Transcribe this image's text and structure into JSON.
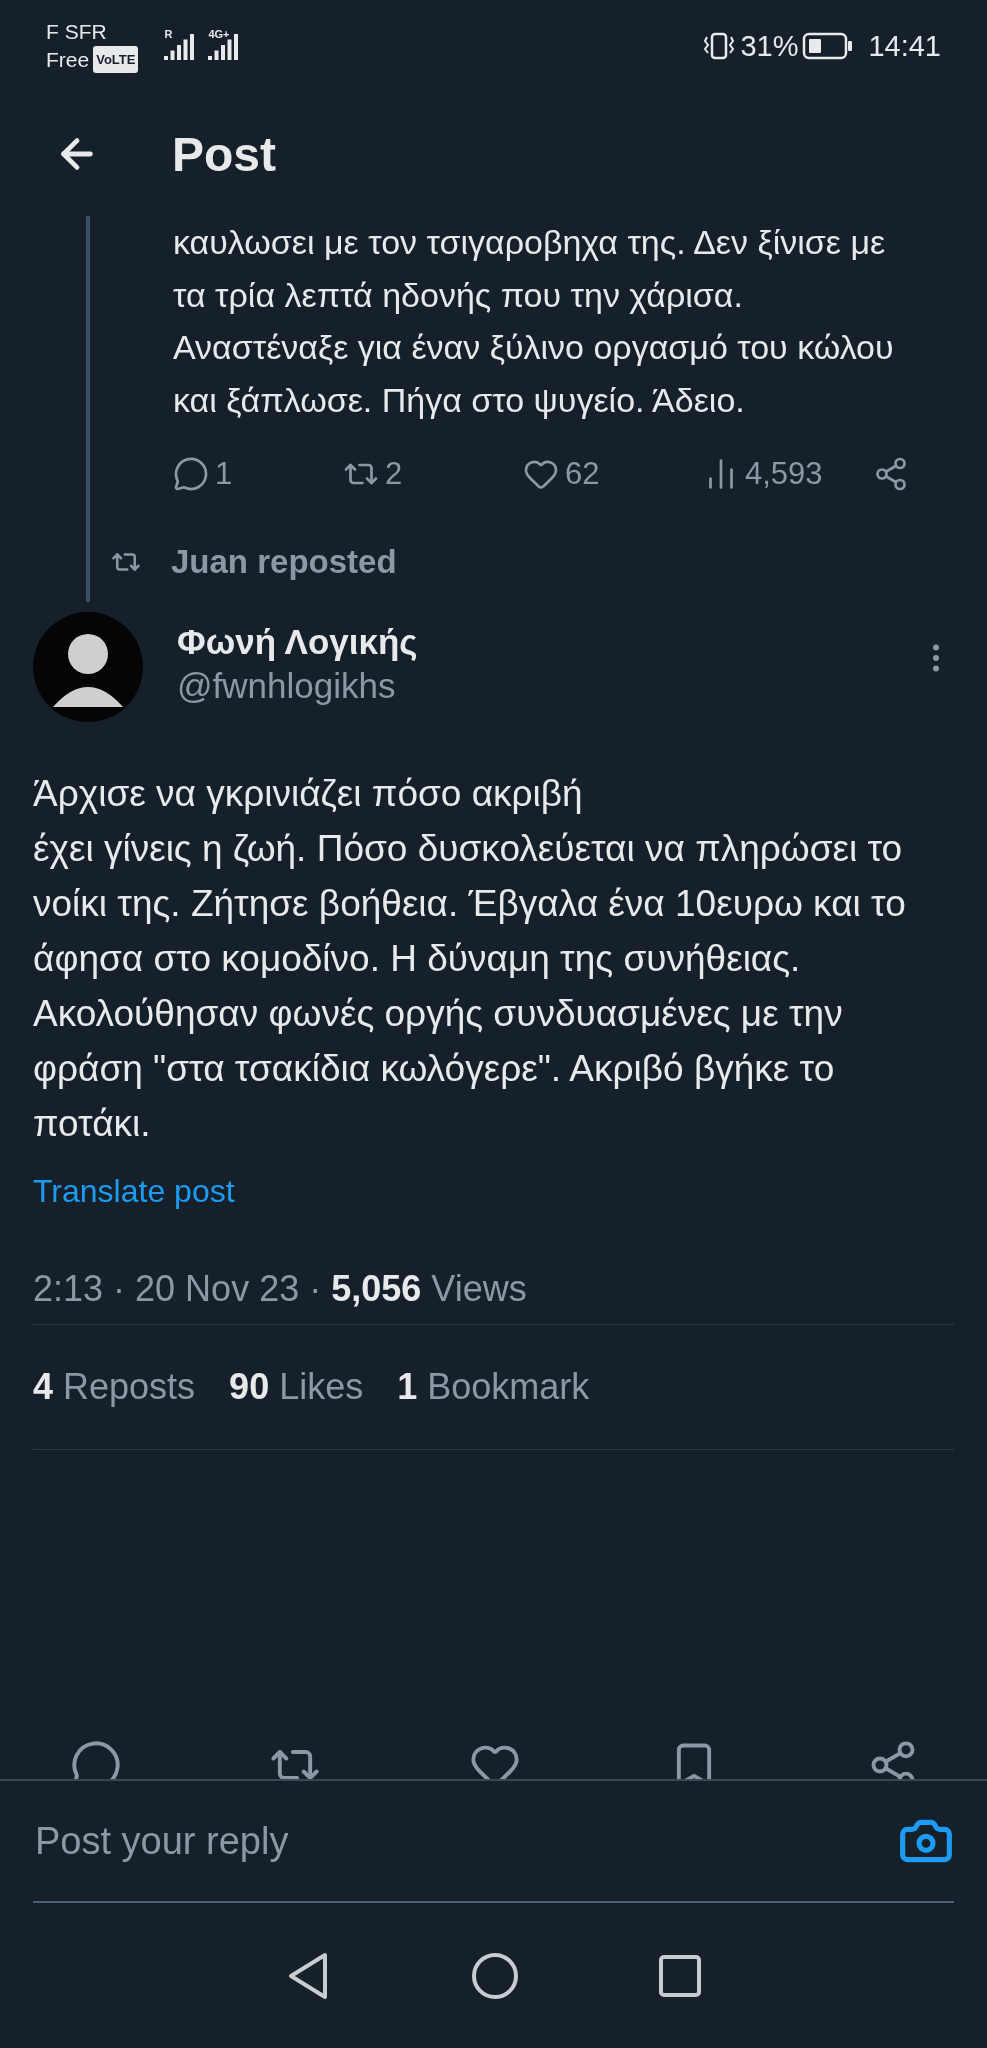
{
  "status_bar": {
    "carrier": "F SFR",
    "network": "Free",
    "volte": "VoLTE",
    "roaming": "R",
    "generation": "4G+",
    "battery": "31%",
    "time": "14:41"
  },
  "header": {
    "title": "Post"
  },
  "previous_post": {
    "text": "καυλωσει με τον τσιγαροβηχα της. Δεν ξίνισε με τα τρία λεπτά ηδονής που την χάρισα. Αναστέναξε για έναν ξύλινο οργασμό του κώλου και ξάπλωσε. Πήγα στο ψυγείο. Άδειο.",
    "actions": [
      {
        "kind": "reply",
        "count": "1"
      },
      {
        "kind": "repost",
        "count": "2"
      },
      {
        "kind": "like",
        "count": "62"
      },
      {
        "kind": "views",
        "count": "4,593"
      },
      {
        "kind": "share"
      }
    ]
  },
  "repost_header": {
    "text": "Juan reposted"
  },
  "post": {
    "author": "Φωνή Λογικής",
    "handle": "@fwnhlogikhs",
    "text": "Άρχισε να γκρινιάζει πόσο ακριβή\nέχει γίνεις η ζωή. Πόσο δυσκολεύεται να πληρώσει το νοίκι της. Ζήτησε βοήθεια. Έβγαλα ένα 10ευρω και το άφησα στο κομοδίνο. Η δύναμη της συνήθειας. Ακολούθησαν φωνές οργής συνδυασμένες με την φράση \"στα τσακίδια κωλόγερε\". Ακριβό βγήκε το ποτάκι.",
    "translate": "Translate post",
    "time": "2:13",
    "separator": "·",
    "date": "20 Nov 23",
    "views_count": "5,056",
    "views_label": "Views",
    "stats": [
      {
        "count": "4",
        "label": "Reposts"
      },
      {
        "count": "90",
        "label": "Likes"
      },
      {
        "count": "1",
        "label": "Bookmark"
      }
    ],
    "actions": [
      {
        "kind": "reply"
      },
      {
        "kind": "repost"
      },
      {
        "kind": "like"
      },
      {
        "kind": "bookmark"
      },
      {
        "kind": "share"
      }
    ]
  },
  "reply_bar": {
    "placeholder": "Post your reply"
  },
  "nav_bar": {
    "buttons": [
      {
        "kind": "back"
      },
      {
        "kind": "home"
      },
      {
        "kind": "recents"
      }
    ]
  }
}
